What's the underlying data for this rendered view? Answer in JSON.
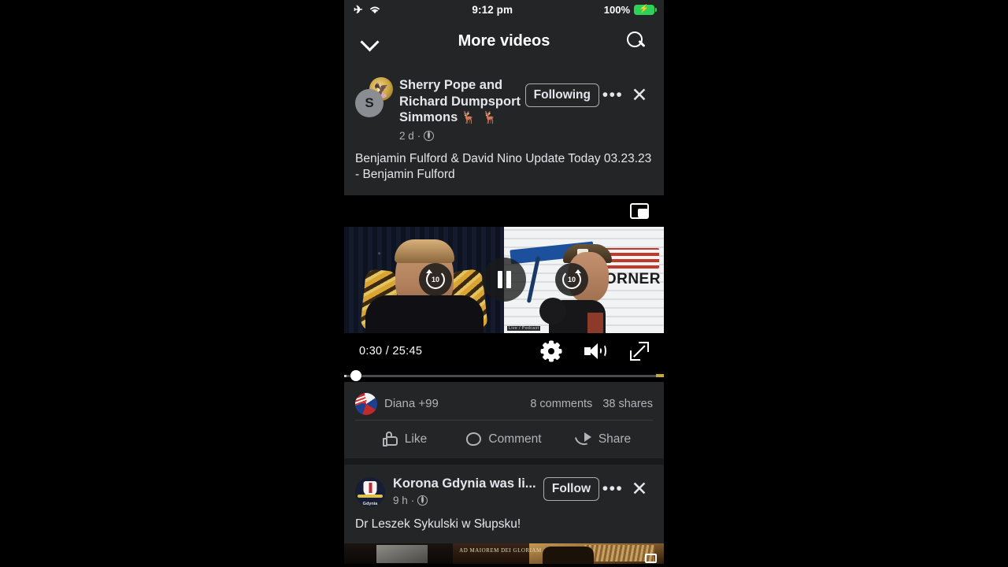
{
  "status_bar": {
    "airplane_icon": "airplane-mode-icon",
    "wifi_icon": "wifi-icon",
    "time": "9:12 pm",
    "battery_percent": "100%",
    "battery_icon": "battery-charging-icon"
  },
  "nav": {
    "collapse_icon": "chevron-down-icon",
    "title": "More videos",
    "search_icon": "search-icon"
  },
  "posts": [
    {
      "avatar_initial": "S",
      "avatar_badge": "eagle-seal-icon",
      "author": "Sherry Pope and Richard Dumpsport Simmons",
      "author_emoji": "🦌 🦌",
      "timestamp": "2 d",
      "privacy_icon": "globe-icon",
      "follow_label": "Following",
      "more_icon": "ellipsis-icon",
      "close_icon": "close-icon",
      "body": "Benjamin Fulford & David Nino Update Today 03.23.23 - Benjamin Fulford",
      "video": {
        "pip_icon": "picture-in-picture-icon",
        "rewind_label": "10",
        "forward_label": "10",
        "play_state": "pause",
        "current_time": "0:30",
        "duration": "25:45",
        "time_display": "0:30 / 25:45",
        "settings_icon": "gear-icon",
        "volume_icon": "volume-up-icon",
        "fullscreen_icon": "expand-icon",
        "progress_percent": 2,
        "thumb_left_caption": "CORNER",
        "thumb_watermark": "Live / Podcast"
      },
      "engagement": {
        "reactor_name": "Diana +99",
        "reactor_avatar": "flag-avatar",
        "comments": "8 comments",
        "shares": "38 shares",
        "actions": [
          {
            "label": "Like",
            "icon": "thumbs-up-icon"
          },
          {
            "label": "Comment",
            "icon": "comment-bubble-icon"
          },
          {
            "label": "Share",
            "icon": "share-arrow-icon"
          }
        ]
      }
    },
    {
      "avatar_label": "Gdynia",
      "avatar_icon": "korona-gdynia-crest-icon",
      "author": "Korona Gdynia was li...",
      "timestamp": "9 h",
      "privacy_icon": "globe-icon",
      "follow_label": "Follow",
      "more_icon": "ellipsis-icon",
      "close_icon": "close-icon",
      "body": "Dr Leszek Sykulski w Słupsku!",
      "thumbnail_text": "AD MAIOREM DEI GLORIAM",
      "pip_icon": "picture-in-picture-icon"
    }
  ],
  "colors": {
    "page_bg": "#000000",
    "card_bg": "#242526",
    "app_bg": "#18191a",
    "text_primary": "#e4e6eb",
    "text_secondary": "#b0b3b8",
    "divider": "#3a3b3c",
    "battery_green": "#2fd058",
    "progress_gold": "#c8a93a"
  }
}
